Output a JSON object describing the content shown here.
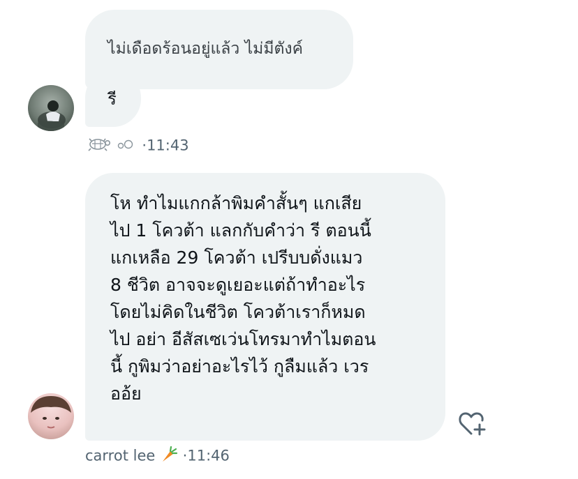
{
  "messages": [
    {
      "text": "ไม่เดือดร้อนอยู่แล้ว ไม่มีตังค์"
    },
    {
      "text": "รี",
      "meta": {
        "separator": "·",
        "time": "11:43"
      }
    },
    {
      "lines": [
        "โห ทำไมแกกล้าพิมคำสั้นๆ แกเสีย",
        "ไป 1 โควต้า แลกกับคำว่า รี ตอนนี้",
        "แกเหลือ 29 โควต้า เปรีบบดั่งแมว",
        "8 ชีวิต อาจจะดูเยอะแต่ถ้าทำอะไร",
        "โดยไม่คิดในชีวิต โควต้าเราก็หมด",
        "ไป อย่า อีสัสเซเว่นโทรมาทำไมตอน",
        "นี้ กูพิมว่าอย่าอะไรไว้ กูลืมแล้ว เวร",
        "ออ้ย"
      ],
      "meta": {
        "sender": "carrot lee",
        "separator": "·",
        "time": "11:46"
      }
    }
  ],
  "icons": {
    "turtle": "turtle-icon",
    "bubbles": "bubbles-icon",
    "carrot": "carrot-icon",
    "add_reaction": "heart-plus-icon"
  },
  "colors": {
    "bubble_bg": "#eff3f4",
    "text": "#0f1419",
    "meta": "#536471"
  }
}
